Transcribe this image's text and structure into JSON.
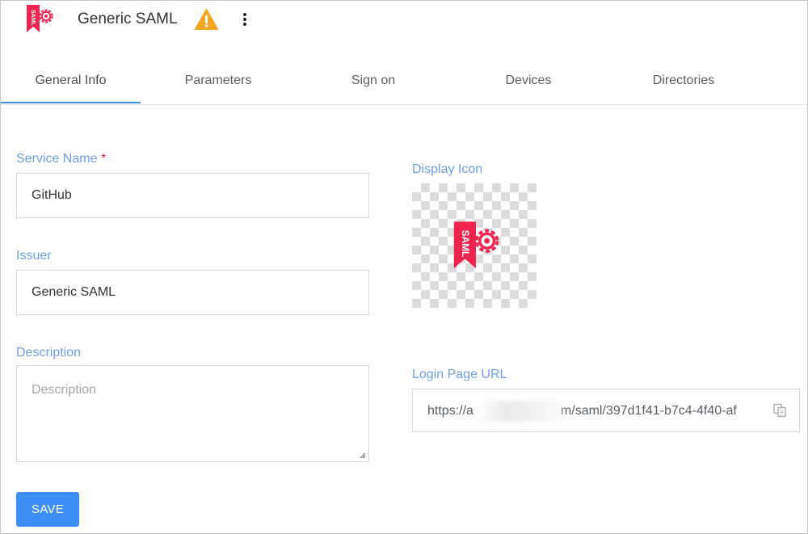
{
  "header": {
    "title": "Generic SAML",
    "logo_icon": "saml-logo-icon",
    "logo_text": "SAML",
    "warning_icon": "warning-icon",
    "menu_icon": "more-vertical-icon",
    "brand_color": "#f0244f",
    "warning_color": "#f5a623"
  },
  "tabs": [
    {
      "label": "General Info",
      "active": true
    },
    {
      "label": "Parameters",
      "active": false
    },
    {
      "label": "Sign on",
      "active": false
    },
    {
      "label": "Devices",
      "active": false
    },
    {
      "label": "Directories",
      "active": false
    }
  ],
  "form": {
    "service_name": {
      "label": "Service Name",
      "required_mark": "*",
      "value": "GitHub"
    },
    "issuer": {
      "label": "Issuer",
      "value": "Generic SAML"
    },
    "description": {
      "label": "Description",
      "value": "",
      "placeholder": "Description"
    },
    "save_label": "SAVE"
  },
  "display_icon": {
    "label": "Display Icon",
    "icon": "saml-logo-icon"
  },
  "login_url": {
    "label": "Login Page URL",
    "value_prefix": "https://a",
    "value_suffix": "m/saml/397d1f41-b7c4-4f40-af",
    "copy_icon": "copy-icon"
  },
  "colors": {
    "accent": "#3d8ef5",
    "label": "#6ea0e6",
    "required": "#d8283a"
  }
}
